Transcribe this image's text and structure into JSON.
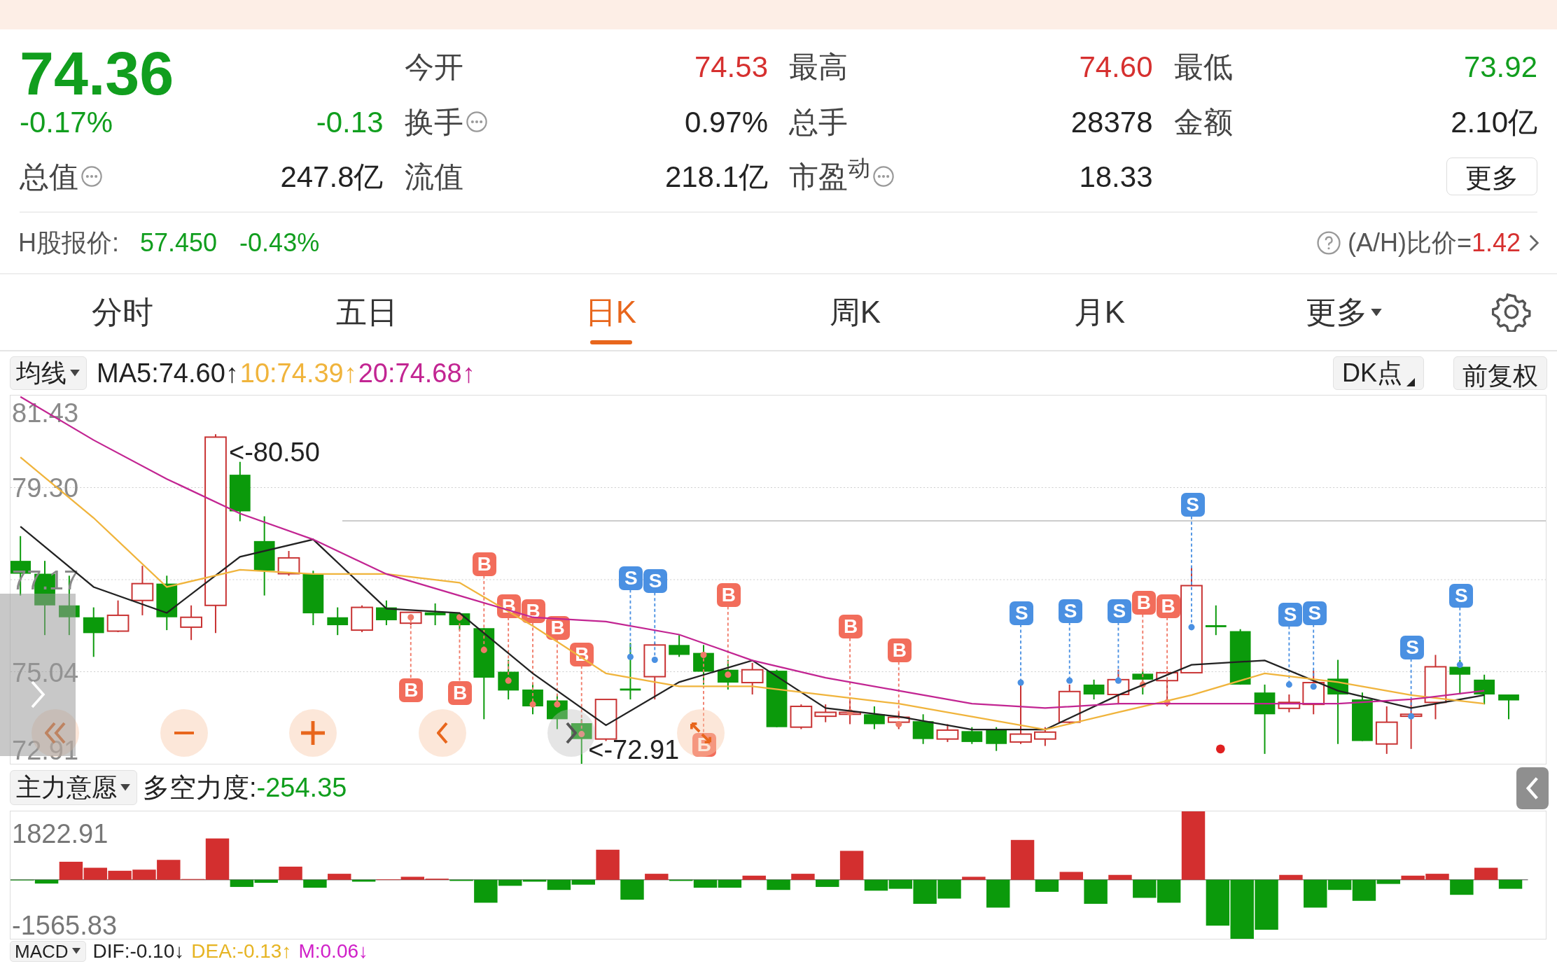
{
  "quote": {
    "price": "74.36",
    "change_pct": "-0.17%",
    "change": "-0.13",
    "color": "#119e1e"
  },
  "stats": [
    {
      "label": "今开",
      "value": "74.53",
      "color": "#d6302f",
      "info": false
    },
    {
      "label": "最高",
      "value": "74.60",
      "color": "#d6302f",
      "info": false
    },
    {
      "label": "最低",
      "value": "73.92",
      "color": "#119e1e",
      "info": false
    },
    {
      "label": "换手",
      "value": "0.97%",
      "color": "#222222",
      "info": true
    },
    {
      "label": "总手",
      "value": "28378",
      "color": "#222222",
      "info": false
    },
    {
      "label": "金额",
      "value": "2.10亿",
      "color": "#222222",
      "info": false
    },
    {
      "label": "总值",
      "value": "247.8亿",
      "color": "#222222",
      "info": true
    },
    {
      "label": "流值",
      "value": "218.1亿",
      "color": "#222222",
      "info": false
    },
    {
      "label": "市盈$^{动}$",
      "value": "18.33",
      "color": "#222222",
      "info": true
    }
  ],
  "more_button": "更多",
  "h_share": {
    "label": "H股报价:",
    "price": "57.450",
    "change_pct": "-0.43%",
    "color": "#119e1e",
    "ratio_label": "(A/H)比价=",
    "ratio_value": "1.42"
  },
  "tabs": [
    {
      "label": "分时",
      "selected": false,
      "dropdown": false
    },
    {
      "label": "五日",
      "selected": false,
      "dropdown": false
    },
    {
      "label": "日K",
      "selected": true,
      "dropdown": false
    },
    {
      "label": "周K",
      "selected": false,
      "dropdown": false
    },
    {
      "label": "月K",
      "selected": false,
      "dropdown": false
    },
    {
      "label": "更多",
      "selected": false,
      "dropdown": true
    }
  ],
  "ma_bar": {
    "selector": "均线",
    "items": [
      {
        "text": "MA5:74.60↑",
        "color": "#222222"
      },
      {
        "text": "10:74.39↑",
        "color": "#f0b43c"
      },
      {
        "text": "20:74.68↑",
        "color": "#c22592"
      }
    ],
    "dk_button": "DK点",
    "adjust_button": "前复权"
  },
  "kline": {
    "high_marker": "<-80.50",
    "low_marker": "<-72.91",
    "top_label": "81.43",
    "bottom_label": "72.91",
    "chart_data": {
      "type": "line",
      "ylim": [
        72.91,
        81.43
      ],
      "grid": true,
      "yticks": [
        {
          "value": 79.3,
          "label": "79.30"
        },
        {
          "value": 77.17,
          "label": "77.17"
        },
        {
          "value": 75.04,
          "label": "75.04"
        }
      ],
      "categories": [
        null,
        null,
        null,
        null,
        null,
        null,
        null,
        null,
        null,
        null,
        null,
        null,
        null,
        null,
        null,
        null,
        null,
        null,
        null,
        null,
        null
      ],
      "series": [
        {
          "color": "#222222",
          "values": [
            78.4,
            77.0,
            76.4,
            77.7,
            78.1,
            76.5,
            76.4,
            75.0,
            73.8,
            74.8,
            75.3,
            74.2,
            74.0,
            73.7,
            73.7,
            74.5,
            75.2,
            75.3,
            74.6,
            74.2,
            74.5
          ]
        },
        {
          "color": "#f0b43c",
          "values": [
            80.0,
            78.6,
            77.0,
            77.4,
            77.3,
            77.3,
            77.1,
            76.1,
            75.0,
            74.7,
            74.7,
            74.5,
            74.3,
            74.0,
            73.7,
            74.1,
            74.5,
            75.0,
            74.8,
            74.5,
            74.3
          ]
        },
        {
          "color": "#c22592",
          "values": [
            81.4,
            80.4,
            79.5,
            78.7,
            78.1,
            77.3,
            76.8,
            76.3,
            76.2,
            75.9,
            75.3,
            74.9,
            74.6,
            74.3,
            74.2,
            74.3,
            74.3,
            74.3,
            74.3,
            74.4,
            74.6
          ]
        }
      ]
    },
    "signals": [
      {
        "label": "B",
        "kind": "buy"
      },
      {
        "label": "B",
        "kind": "buy"
      },
      {
        "label": "B",
        "kind": "buy"
      },
      {
        "label": "B",
        "kind": "buy"
      },
      {
        "label": "B",
        "kind": "buy"
      },
      {
        "label": "B",
        "kind": "buy"
      },
      {
        "label": "B",
        "kind": "buy"
      },
      {
        "label": "S",
        "kind": "sell"
      },
      {
        "label": "S",
        "kind": "sell"
      },
      {
        "label": "B",
        "kind": "buy"
      },
      {
        "label": "B",
        "kind": "buy"
      },
      {
        "label": "B",
        "kind": "buy"
      },
      {
        "label": "B",
        "kind": "buy"
      },
      {
        "label": "S",
        "kind": "sell"
      },
      {
        "label": "S",
        "kind": "sell"
      },
      {
        "label": "S",
        "kind": "sell"
      },
      {
        "label": "B",
        "kind": "buy"
      },
      {
        "label": "B",
        "kind": "buy"
      },
      {
        "label": "S",
        "kind": "sell"
      },
      {
        "label": "S",
        "kind": "sell"
      },
      {
        "label": "S",
        "kind": "sell"
      },
      {
        "label": "S",
        "kind": "sell"
      },
      {
        "label": "S",
        "kind": "sell"
      }
    ]
  },
  "indicator": {
    "selector": "主力意愿",
    "label": "多空力度:",
    "value": "-254.35",
    "color": "#119e1e",
    "max_label": "1822.91",
    "min_label": "-1565.83"
  },
  "macd": {
    "selector": "MACD",
    "items": [
      {
        "text": "DIF:-0.10↓",
        "color": "#222222"
      },
      {
        "text": "DEA:-0.13↑",
        "color": "#e6b422"
      },
      {
        "text": "M:0.06↓",
        "color": "#d020c8"
      }
    ]
  }
}
